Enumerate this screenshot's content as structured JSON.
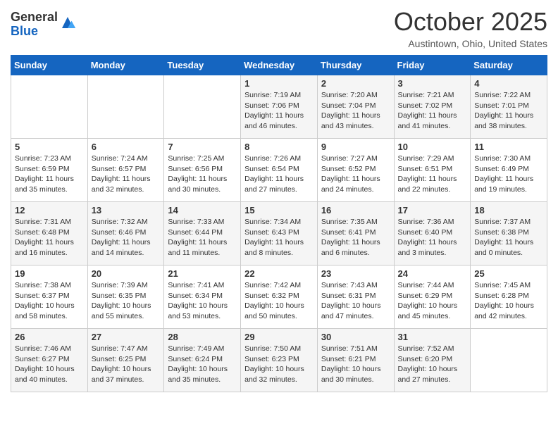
{
  "header": {
    "logo_general": "General",
    "logo_blue": "Blue",
    "month": "October 2025",
    "location": "Austintown, Ohio, United States"
  },
  "days_of_week": [
    "Sunday",
    "Monday",
    "Tuesday",
    "Wednesday",
    "Thursday",
    "Friday",
    "Saturday"
  ],
  "weeks": [
    [
      {
        "day": "",
        "sunrise": "",
        "sunset": "",
        "daylight": ""
      },
      {
        "day": "",
        "sunrise": "",
        "sunset": "",
        "daylight": ""
      },
      {
        "day": "",
        "sunrise": "",
        "sunset": "",
        "daylight": ""
      },
      {
        "day": "1",
        "sunrise": "Sunrise: 7:19 AM",
        "sunset": "Sunset: 7:06 PM",
        "daylight": "Daylight: 11 hours and 46 minutes."
      },
      {
        "day": "2",
        "sunrise": "Sunrise: 7:20 AM",
        "sunset": "Sunset: 7:04 PM",
        "daylight": "Daylight: 11 hours and 43 minutes."
      },
      {
        "day": "3",
        "sunrise": "Sunrise: 7:21 AM",
        "sunset": "Sunset: 7:02 PM",
        "daylight": "Daylight: 11 hours and 41 minutes."
      },
      {
        "day": "4",
        "sunrise": "Sunrise: 7:22 AM",
        "sunset": "Sunset: 7:01 PM",
        "daylight": "Daylight: 11 hours and 38 minutes."
      }
    ],
    [
      {
        "day": "5",
        "sunrise": "Sunrise: 7:23 AM",
        "sunset": "Sunset: 6:59 PM",
        "daylight": "Daylight: 11 hours and 35 minutes."
      },
      {
        "day": "6",
        "sunrise": "Sunrise: 7:24 AM",
        "sunset": "Sunset: 6:57 PM",
        "daylight": "Daylight: 11 hours and 32 minutes."
      },
      {
        "day": "7",
        "sunrise": "Sunrise: 7:25 AM",
        "sunset": "Sunset: 6:56 PM",
        "daylight": "Daylight: 11 hours and 30 minutes."
      },
      {
        "day": "8",
        "sunrise": "Sunrise: 7:26 AM",
        "sunset": "Sunset: 6:54 PM",
        "daylight": "Daylight: 11 hours and 27 minutes."
      },
      {
        "day": "9",
        "sunrise": "Sunrise: 7:27 AM",
        "sunset": "Sunset: 6:52 PM",
        "daylight": "Daylight: 11 hours and 24 minutes."
      },
      {
        "day": "10",
        "sunrise": "Sunrise: 7:29 AM",
        "sunset": "Sunset: 6:51 PM",
        "daylight": "Daylight: 11 hours and 22 minutes."
      },
      {
        "day": "11",
        "sunrise": "Sunrise: 7:30 AM",
        "sunset": "Sunset: 6:49 PM",
        "daylight": "Daylight: 11 hours and 19 minutes."
      }
    ],
    [
      {
        "day": "12",
        "sunrise": "Sunrise: 7:31 AM",
        "sunset": "Sunset: 6:48 PM",
        "daylight": "Daylight: 11 hours and 16 minutes."
      },
      {
        "day": "13",
        "sunrise": "Sunrise: 7:32 AM",
        "sunset": "Sunset: 6:46 PM",
        "daylight": "Daylight: 11 hours and 14 minutes."
      },
      {
        "day": "14",
        "sunrise": "Sunrise: 7:33 AM",
        "sunset": "Sunset: 6:44 PM",
        "daylight": "Daylight: 11 hours and 11 minutes."
      },
      {
        "day": "15",
        "sunrise": "Sunrise: 7:34 AM",
        "sunset": "Sunset: 6:43 PM",
        "daylight": "Daylight: 11 hours and 8 minutes."
      },
      {
        "day": "16",
        "sunrise": "Sunrise: 7:35 AM",
        "sunset": "Sunset: 6:41 PM",
        "daylight": "Daylight: 11 hours and 6 minutes."
      },
      {
        "day": "17",
        "sunrise": "Sunrise: 7:36 AM",
        "sunset": "Sunset: 6:40 PM",
        "daylight": "Daylight: 11 hours and 3 minutes."
      },
      {
        "day": "18",
        "sunrise": "Sunrise: 7:37 AM",
        "sunset": "Sunset: 6:38 PM",
        "daylight": "Daylight: 11 hours and 0 minutes."
      }
    ],
    [
      {
        "day": "19",
        "sunrise": "Sunrise: 7:38 AM",
        "sunset": "Sunset: 6:37 PM",
        "daylight": "Daylight: 10 hours and 58 minutes."
      },
      {
        "day": "20",
        "sunrise": "Sunrise: 7:39 AM",
        "sunset": "Sunset: 6:35 PM",
        "daylight": "Daylight: 10 hours and 55 minutes."
      },
      {
        "day": "21",
        "sunrise": "Sunrise: 7:41 AM",
        "sunset": "Sunset: 6:34 PM",
        "daylight": "Daylight: 10 hours and 53 minutes."
      },
      {
        "day": "22",
        "sunrise": "Sunrise: 7:42 AM",
        "sunset": "Sunset: 6:32 PM",
        "daylight": "Daylight: 10 hours and 50 minutes."
      },
      {
        "day": "23",
        "sunrise": "Sunrise: 7:43 AM",
        "sunset": "Sunset: 6:31 PM",
        "daylight": "Daylight: 10 hours and 47 minutes."
      },
      {
        "day": "24",
        "sunrise": "Sunrise: 7:44 AM",
        "sunset": "Sunset: 6:29 PM",
        "daylight": "Daylight: 10 hours and 45 minutes."
      },
      {
        "day": "25",
        "sunrise": "Sunrise: 7:45 AM",
        "sunset": "Sunset: 6:28 PM",
        "daylight": "Daylight: 10 hours and 42 minutes."
      }
    ],
    [
      {
        "day": "26",
        "sunrise": "Sunrise: 7:46 AM",
        "sunset": "Sunset: 6:27 PM",
        "daylight": "Daylight: 10 hours and 40 minutes."
      },
      {
        "day": "27",
        "sunrise": "Sunrise: 7:47 AM",
        "sunset": "Sunset: 6:25 PM",
        "daylight": "Daylight: 10 hours and 37 minutes."
      },
      {
        "day": "28",
        "sunrise": "Sunrise: 7:49 AM",
        "sunset": "Sunset: 6:24 PM",
        "daylight": "Daylight: 10 hours and 35 minutes."
      },
      {
        "day": "29",
        "sunrise": "Sunrise: 7:50 AM",
        "sunset": "Sunset: 6:23 PM",
        "daylight": "Daylight: 10 hours and 32 minutes."
      },
      {
        "day": "30",
        "sunrise": "Sunrise: 7:51 AM",
        "sunset": "Sunset: 6:21 PM",
        "daylight": "Daylight: 10 hours and 30 minutes."
      },
      {
        "day": "31",
        "sunrise": "Sunrise: 7:52 AM",
        "sunset": "Sunset: 6:20 PM",
        "daylight": "Daylight: 10 hours and 27 minutes."
      },
      {
        "day": "",
        "sunrise": "",
        "sunset": "",
        "daylight": ""
      }
    ]
  ]
}
